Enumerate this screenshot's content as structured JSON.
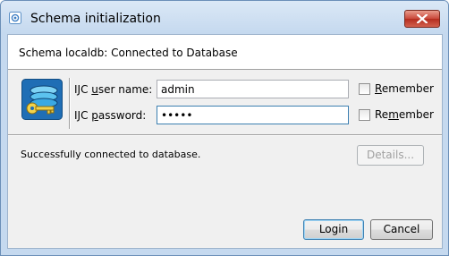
{
  "window": {
    "title": "Schema initialization",
    "close_label": "Close"
  },
  "header": {
    "text": "Schema localdb: Connected to Database"
  },
  "form": {
    "username": {
      "label_prefix": "IJC ",
      "label_underlined": "u",
      "label_suffix": "ser name:",
      "value": "admin",
      "remember_underlined": "R",
      "remember_suffix": "emember",
      "remember_checked": false
    },
    "password": {
      "label_prefix": "IJC ",
      "label_underlined": "p",
      "label_suffix": "assword:",
      "value": "•••••",
      "remember_prefix": "Re",
      "remember_underlined": "m",
      "remember_suffix": "ember",
      "remember_checked": false
    }
  },
  "status": {
    "text": "Successfully connected to database."
  },
  "buttons": {
    "details": "Details...",
    "login": "Login",
    "cancel": "Cancel"
  },
  "colors": {
    "title_bar": "#c5d9ef",
    "close_button": "#c9483a",
    "client_bg": "#f0f0f0",
    "focus_border": "#3c7fb1"
  },
  "icons": {
    "app": "schema-app-icon",
    "database_key": "database-key-icon",
    "close": "close-icon"
  }
}
